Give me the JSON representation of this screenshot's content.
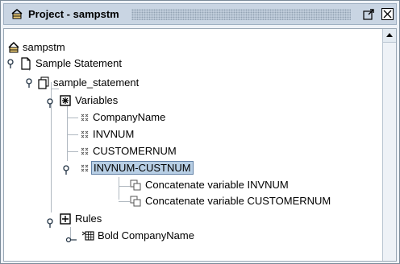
{
  "window": {
    "title": "Project - sampstm"
  },
  "tree": {
    "root": "sampstm",
    "statement": "Sample Statement",
    "statement_child": "sample_statement",
    "variables": "Variables",
    "vars": [
      "CompanyName",
      "INVNUM",
      "CUSTOMERNUM",
      "INVNUM-CUSTNUM"
    ],
    "concat": [
      "Concatenate variable INVNUM",
      "Concatenate variable CUSTOMERNUM"
    ],
    "rules": "Rules",
    "rule_items": [
      "Bold CompanyName"
    ]
  },
  "colors": {
    "selection": "#b8cfe5",
    "titlebar": "#c9d5e3"
  }
}
